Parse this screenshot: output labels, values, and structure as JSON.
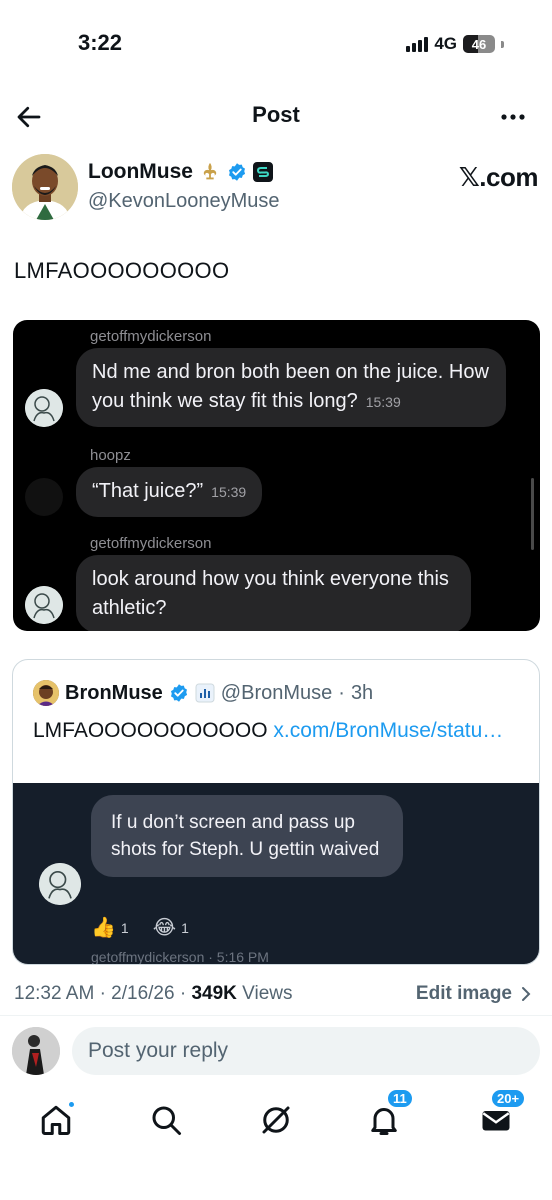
{
  "status_bar": {
    "time": "3:22",
    "network": "4G",
    "battery": "46",
    "battery_level": 0.46
  },
  "nav": {
    "title": "Post"
  },
  "post": {
    "author_name": "LoonMuse",
    "author_handle": "@KevonLooneyMuse",
    "source_label": "𝕏.com",
    "text": "LMFAOOOOOOOOO",
    "image_chat": [
      {
        "sender": "getoffmydickerson",
        "text": "Nd me and bron both been on the juice. How you think we stay fit this long?",
        "time": "15:39"
      },
      {
        "sender": "hoopz",
        "text": "“That juice?”",
        "time": "15:39"
      },
      {
        "sender": "getoffmydickerson",
        "text": "look around how you think everyone this athletic?",
        "time": ""
      }
    ]
  },
  "quote": {
    "name": "BronMuse",
    "handle": "@BronMuse",
    "separator": "·",
    "age": "3h",
    "text": "LMFAOOOOOOOOOOO",
    "link": "x.com/BronMuse/statu…",
    "image_bubble": "If u don’t screen and pass up shots for Steph. U gettin waived",
    "reactions": [
      {
        "emoji": "👍",
        "count": "1"
      },
      {
        "emoji": "😂",
        "count": "1"
      }
    ],
    "image_footer": "getoffmydickerson · 5:16 PM"
  },
  "meta": {
    "time": "12:32 AM",
    "sep": "·",
    "date": "2/16/26",
    "sep2": "·",
    "views_count": "349K",
    "views_label": "Views",
    "edit_image": "Edit image"
  },
  "reply": {
    "placeholder": "Post your reply"
  },
  "tabbar": {
    "notifications_badge": "11",
    "messages_badge": "20+"
  },
  "icons": [
    "back-arrow-icon",
    "more-icon",
    "verified-icon",
    "app-badge-icon",
    "chevron-right-icon",
    "home-icon",
    "search-icon",
    "grok-icon",
    "bell-icon",
    "mail-icon"
  ],
  "colors": {
    "accent": "#1d9bf0",
    "text": "#0f1419",
    "secondary": "#536471",
    "quote_media_bg": "#151e2a"
  }
}
